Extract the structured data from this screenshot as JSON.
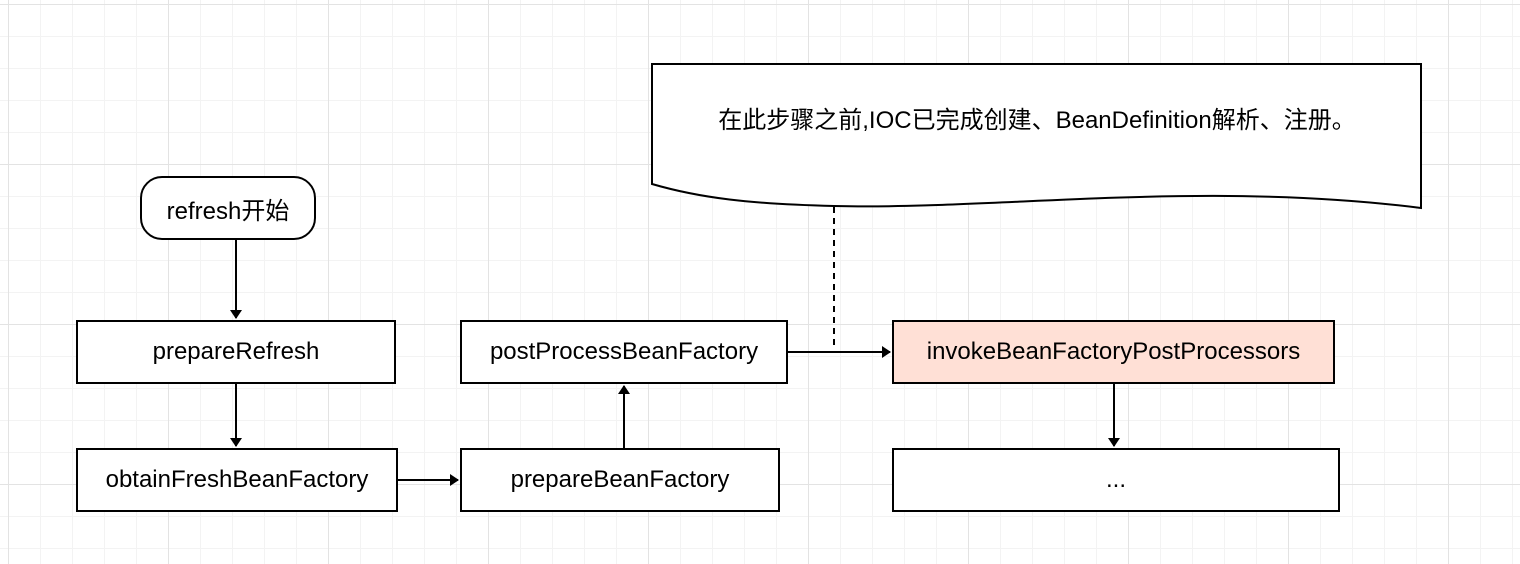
{
  "nodes": {
    "start": "refresh开始",
    "prepare_refresh": "prepareRefresh",
    "obtain_fresh_bean_factory": "obtainFreshBeanFactory",
    "prepare_bean_factory": "prepareBeanFactory",
    "post_process_bean_factory": "postProcessBeanFactory",
    "invoke_bean_factory_post_processors": "invokeBeanFactoryPostProcessors",
    "ellipsis": "..."
  },
  "note": {
    "text": "在此步骤之前,IOC已完成创建、BeanDefinition解析、注册。"
  },
  "colors": {
    "highlight": "#ffe0d6",
    "stroke": "#000000"
  }
}
